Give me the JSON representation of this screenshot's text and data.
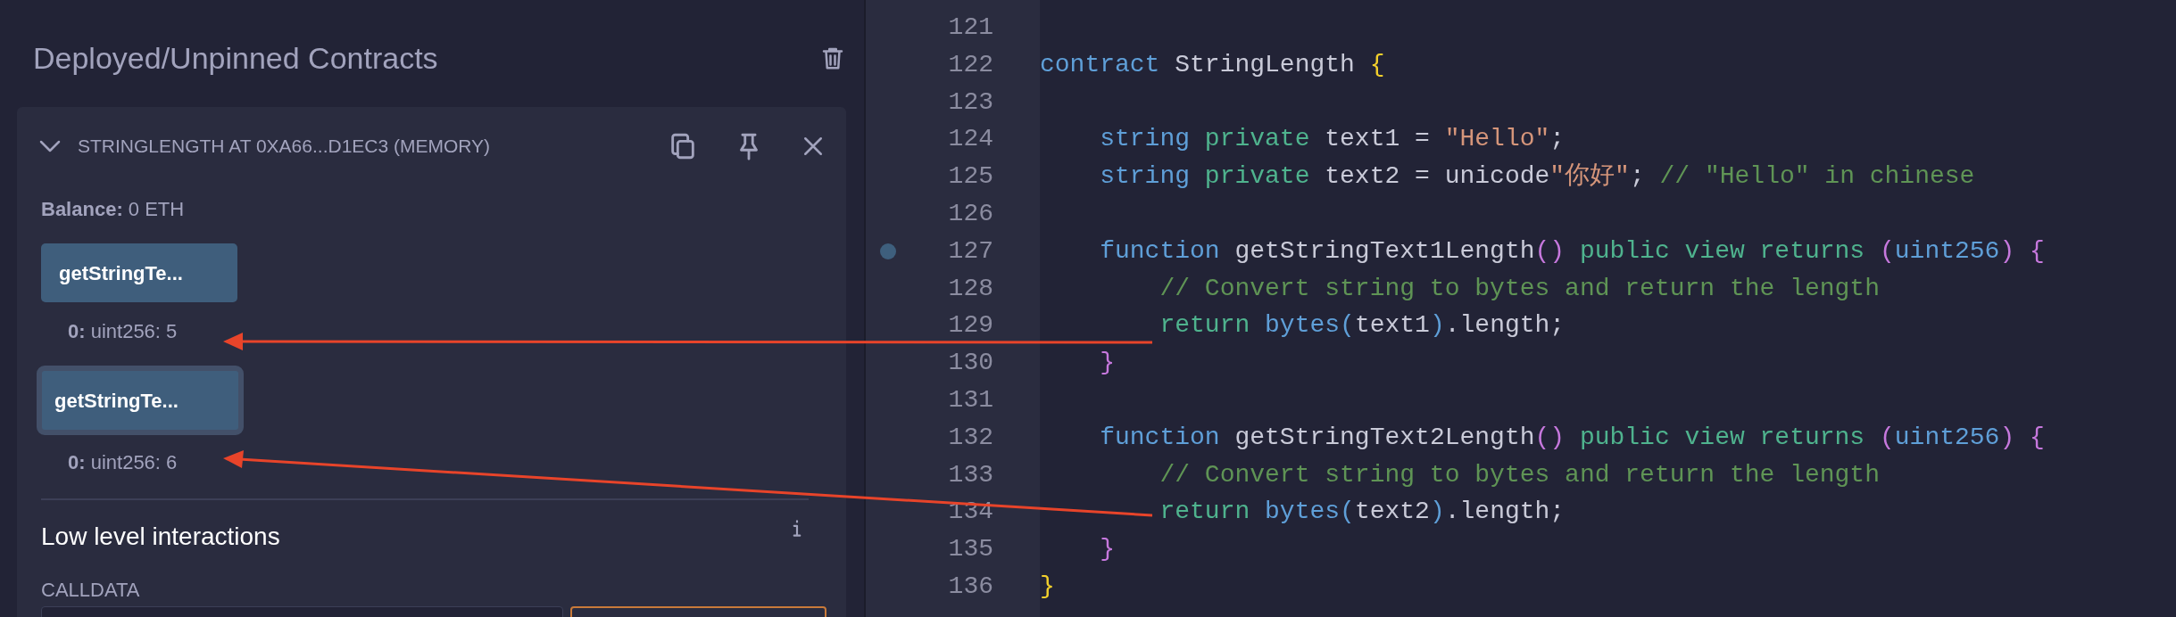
{
  "panel": {
    "title": "Deployed/Unpinned Contracts",
    "contract": {
      "title": "STRINGLENGTH AT 0XA66...D1EC3 (MEMORY)",
      "expanded": true,
      "balance": "**Balance:** 0 ETH",
      "functions": [
        {
          "label": "getStringTe...",
          "focused": false,
          "result": "**0:** uint256: 5"
        },
        {
          "label": "getStringTe...",
          "focused": true,
          "result": "**0:** uint256: 6"
        }
      ],
      "low_level": {
        "title": "Low level interactions",
        "calldata_label": "CALLDATA"
      }
    }
  },
  "editor": {
    "lines": [
      {
        "number": "121",
        "breakpoint": false
      },
      {
        "number": "122",
        "breakpoint": false,
        "tokens": [
          {
            "text": "contract",
            "kind": "keyword"
          },
          {
            "text": " StringLength ",
            "kind": "plain"
          },
          {
            "text": "{",
            "kind": "brace"
          }
        ]
      },
      {
        "number": "123",
        "breakpoint": false
      },
      {
        "number": "124",
        "breakpoint": false,
        "tokens": [
          {
            "text": "    string",
            "kind": "keyword"
          },
          {
            "text": " private",
            "kind": "modifier"
          },
          {
            "text": " text1 = ",
            "kind": "plain"
          },
          {
            "text": "\"Hello\"",
            "kind": "string"
          },
          {
            "text": ";",
            "kind": "plain"
          }
        ]
      },
      {
        "number": "125",
        "breakpoint": false,
        "tokens": [
          {
            "text": "    string",
            "kind": "keyword"
          },
          {
            "text": " private",
            "kind": "modifier"
          },
          {
            "text": " text2 = unicode",
            "kind": "plain"
          },
          {
            "text": "\"你好\"",
            "kind": "string"
          },
          {
            "text": "; ",
            "kind": "plain"
          },
          {
            "text": "// \"Hello\" in chinese",
            "kind": "comment"
          }
        ]
      },
      {
        "number": "126",
        "breakpoint": false
      },
      {
        "number": "127",
        "breakpoint": true,
        "tokens": [
          {
            "text": "    function",
            "kind": "keyword"
          },
          {
            "text": " getStringText1Length",
            "kind": "plain"
          },
          {
            "text": "()",
            "kind": "bracket"
          },
          {
            "text": " public view returns ",
            "kind": "modifier"
          },
          {
            "text": "(",
            "kind": "bracket"
          },
          {
            "text": "uint256",
            "kind": "keyword"
          },
          {
            "text": ")",
            "kind": "bracket"
          },
          {
            "text": " {",
            "kind": "bracket"
          }
        ]
      },
      {
        "number": "128",
        "breakpoint": false,
        "tokens": [
          {
            "text": "        // Convert string to bytes and return the length",
            "kind": "comment"
          }
        ]
      },
      {
        "number": "129",
        "breakpoint": false,
        "tokens": [
          {
            "text": "        return",
            "kind": "modifier"
          },
          {
            "text": " bytes",
            "kind": "keyword"
          },
          {
            "text": "(",
            "kind": "paren"
          },
          {
            "text": "text1",
            "kind": "plain"
          },
          {
            "text": ")",
            "kind": "paren"
          },
          {
            "text": ".length;",
            "kind": "plain"
          }
        ]
      },
      {
        "number": "130",
        "breakpoint": false,
        "tokens": [
          {
            "text": "    }",
            "kind": "bracket"
          }
        ]
      },
      {
        "number": "131",
        "breakpoint": false
      },
      {
        "number": "132",
        "breakpoint": false,
        "tokens": [
          {
            "text": "    function",
            "kind": "keyword"
          },
          {
            "text": " getStringText2Length",
            "kind": "plain"
          },
          {
            "text": "()",
            "kind": "bracket"
          },
          {
            "text": " public view returns ",
            "kind": "modifier"
          },
          {
            "text": "(",
            "kind": "bracket"
          },
          {
            "text": "uint256",
            "kind": "keyword"
          },
          {
            "text": ")",
            "kind": "bracket"
          },
          {
            "text": " {",
            "kind": "bracket"
          }
        ]
      },
      {
        "number": "133",
        "breakpoint": false,
        "tokens": [
          {
            "text": "        // Convert string to bytes and return the length",
            "kind": "comment"
          }
        ]
      },
      {
        "number": "134",
        "breakpoint": false,
        "tokens": [
          {
            "text": "        return",
            "kind": "modifier"
          },
          {
            "text": " bytes",
            "kind": "keyword"
          },
          {
            "text": "(",
            "kind": "paren"
          },
          {
            "text": "text2",
            "kind": "plain"
          },
          {
            "text": ")",
            "kind": "paren"
          },
          {
            "text": ".length;",
            "kind": "plain"
          }
        ]
      },
      {
        "number": "135",
        "breakpoint": false,
        "tokens": [
          {
            "text": "    }",
            "kind": "bracket"
          }
        ]
      },
      {
        "number": "136",
        "breakpoint": false,
        "tokens": [
          {
            "text": "}",
            "kind": "brace"
          }
        ]
      }
    ]
  }
}
